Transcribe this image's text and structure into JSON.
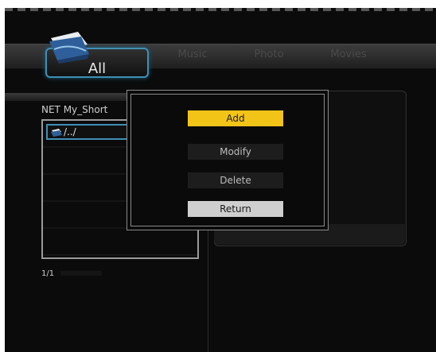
{
  "tabs": {
    "all": "All",
    "music": "Music",
    "photo": "Photo",
    "movies": "Movies"
  },
  "browser": {
    "path": "NET  My_Short",
    "items": [
      {
        "label": "/../"
      }
    ],
    "page": "1/1"
  },
  "dialog": {
    "add": "Add",
    "modify": "Modify",
    "delete": "Delete",
    "return": "Return"
  },
  "colors": {
    "accent": "#3f8fb5",
    "highlight": "#f3c418"
  }
}
